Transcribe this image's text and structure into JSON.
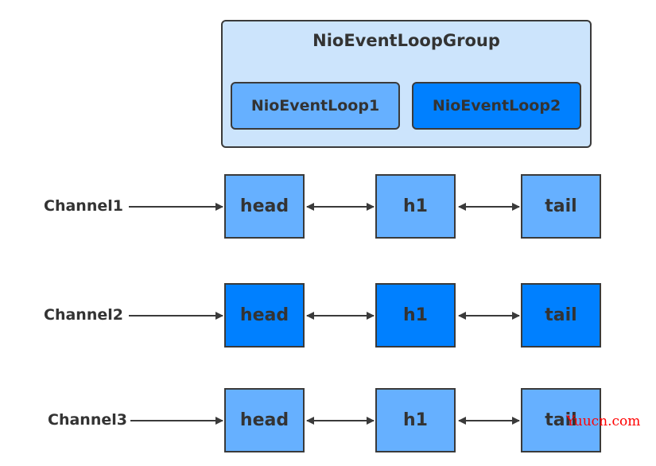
{
  "colors": {
    "light_blue": "#66b0ff",
    "dark_blue": "#0080ff",
    "group_bg": "#cce4fc",
    "stroke": "#3a3a3a",
    "text": "#333333",
    "watermark": "#ff0000"
  },
  "group": {
    "title": "NioEventLoopGroup",
    "loops": [
      {
        "label": "NioEventLoop1",
        "color": "#66b0ff"
      },
      {
        "label": "NioEventLoop2",
        "color": "#0080ff"
      }
    ]
  },
  "channels": [
    {
      "label": "Channel1",
      "color": "#66b0ff",
      "nodes": [
        "head",
        "h1",
        "tail"
      ]
    },
    {
      "label": "Channel2",
      "color": "#0080ff",
      "nodes": [
        "head",
        "h1",
        "tail"
      ]
    },
    {
      "label": "Channel3",
      "color": "#66b0ff",
      "nodes": [
        "head",
        "h1",
        "tail"
      ]
    }
  ],
  "watermark": "Yuucn.com"
}
